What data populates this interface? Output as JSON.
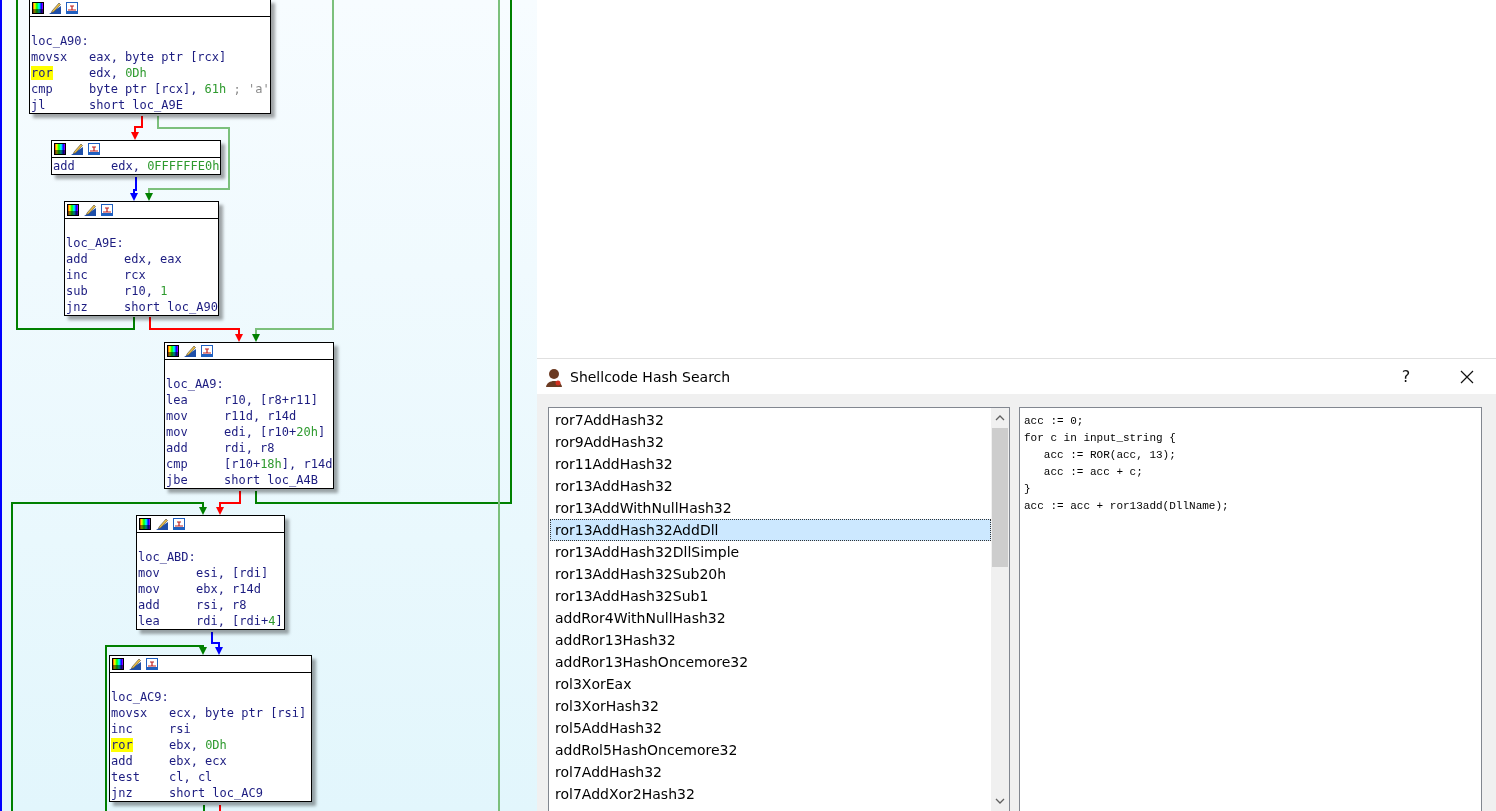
{
  "graph": {
    "nodes": [
      {
        "label": "loc_A90:",
        "lines": [
          {
            "mnemonic": "movsx",
            "highlighted": false,
            "operands": [
              {
                "kind": "text",
                "text": "eax, byte ptr [rcx]"
              }
            ]
          },
          {
            "mnemonic": "ror",
            "highlighted": true,
            "operands": [
              {
                "kind": "text",
                "text": "edx, "
              },
              {
                "kind": "number",
                "text": "0Dh"
              }
            ]
          },
          {
            "mnemonic": "cmp",
            "highlighted": false,
            "operands": [
              {
                "kind": "text",
                "text": "byte ptr [rcx], "
              },
              {
                "kind": "number",
                "text": "61h"
              },
              {
                "kind": "comment",
                "text": " ; 'a'"
              }
            ]
          },
          {
            "mnemonic": "jl",
            "highlighted": false,
            "operands": [
              {
                "kind": "text",
                "text": "short loc_A9E"
              }
            ]
          }
        ]
      },
      {
        "lines": [
          {
            "mnemonic": "add",
            "highlighted": false,
            "operands": [
              {
                "kind": "text",
                "text": "edx, "
              },
              {
                "kind": "number",
                "text": "0FFFFFFE0h"
              }
            ]
          }
        ]
      },
      {
        "label": "loc_A9E:",
        "lines": [
          {
            "mnemonic": "add",
            "highlighted": false,
            "operands": [
              {
                "kind": "text",
                "text": "edx, eax"
              }
            ]
          },
          {
            "mnemonic": "inc",
            "highlighted": false,
            "operands": [
              {
                "kind": "text",
                "text": "rcx"
              }
            ]
          },
          {
            "mnemonic": "sub",
            "highlighted": false,
            "operands": [
              {
                "kind": "text",
                "text": "r10, "
              },
              {
                "kind": "number",
                "text": "1"
              }
            ]
          },
          {
            "mnemonic": "jnz",
            "highlighted": false,
            "operands": [
              {
                "kind": "text",
                "text": "short loc_A90"
              }
            ]
          }
        ]
      },
      {
        "label": "loc_AA9:",
        "lines": [
          {
            "mnemonic": "lea",
            "highlighted": false,
            "operands": [
              {
                "kind": "text",
                "text": "r10, [r8+r11]"
              }
            ]
          },
          {
            "mnemonic": "mov",
            "highlighted": false,
            "operands": [
              {
                "kind": "text",
                "text": "r11d, r14d"
              }
            ]
          },
          {
            "mnemonic": "mov",
            "highlighted": false,
            "operands": [
              {
                "kind": "text",
                "text": "edi, [r10+"
              },
              {
                "kind": "number",
                "text": "20h"
              },
              {
                "kind": "text",
                "text": "]"
              }
            ]
          },
          {
            "mnemonic": "add",
            "highlighted": false,
            "operands": [
              {
                "kind": "text",
                "text": "rdi, r8"
              }
            ]
          },
          {
            "mnemonic": "cmp",
            "highlighted": false,
            "operands": [
              {
                "kind": "text",
                "text": "[r10+"
              },
              {
                "kind": "number",
                "text": "18h"
              },
              {
                "kind": "text",
                "text": "], r14d"
              }
            ]
          },
          {
            "mnemonic": "jbe",
            "highlighted": false,
            "operands": [
              {
                "kind": "text",
                "text": "short loc_A4B"
              }
            ]
          }
        ]
      },
      {
        "label": "loc_ABD:",
        "lines": [
          {
            "mnemonic": "mov",
            "highlighted": false,
            "operands": [
              {
                "kind": "text",
                "text": "esi, [rdi]"
              }
            ]
          },
          {
            "mnemonic": "mov",
            "highlighted": false,
            "operands": [
              {
                "kind": "text",
                "text": "ebx, r14d"
              }
            ]
          },
          {
            "mnemonic": "add",
            "highlighted": false,
            "operands": [
              {
                "kind": "text",
                "text": "rsi, r8"
              }
            ]
          },
          {
            "mnemonic": "lea",
            "highlighted": false,
            "operands": [
              {
                "kind": "text",
                "text": "rdi, [rdi+"
              },
              {
                "kind": "number",
                "text": "4"
              },
              {
                "kind": "text",
                "text": "]"
              }
            ]
          }
        ]
      },
      {
        "label": "loc_AC9:",
        "lines": [
          {
            "mnemonic": "movsx",
            "highlighted": false,
            "operands": [
              {
                "kind": "text",
                "text": "ecx, byte ptr [rsi]"
              }
            ]
          },
          {
            "mnemonic": "inc",
            "highlighted": false,
            "operands": [
              {
                "kind": "text",
                "text": "rsi"
              }
            ]
          },
          {
            "mnemonic": "ror",
            "highlighted": true,
            "operands": [
              {
                "kind": "text",
                "text": "ebx, "
              },
              {
                "kind": "number",
                "text": "0Dh"
              }
            ]
          },
          {
            "mnemonic": "add",
            "highlighted": false,
            "operands": [
              {
                "kind": "text",
                "text": "ebx, ecx"
              }
            ]
          },
          {
            "mnemonic": "test",
            "highlighted": false,
            "operands": [
              {
                "kind": "text",
                "text": "cl, cl"
              }
            ]
          },
          {
            "mnemonic": "jnz",
            "highlighted": false,
            "operands": [
              {
                "kind": "text",
                "text": "short loc_AC9"
              }
            ]
          }
        ]
      }
    ]
  },
  "dialog": {
    "title": "Shellcode Hash Search",
    "help": "?",
    "list": {
      "items": [
        {
          "label": "ror7AddHash32",
          "selected": false
        },
        {
          "label": "ror9AddHash32",
          "selected": false
        },
        {
          "label": "ror11AddHash32",
          "selected": false
        },
        {
          "label": "ror13AddHash32",
          "selected": false
        },
        {
          "label": "ror13AddWithNullHash32",
          "selected": false
        },
        {
          "label": "ror13AddHash32AddDll",
          "selected": true
        },
        {
          "label": "ror13AddHash32DllSimple",
          "selected": false
        },
        {
          "label": "ror13AddHash32Sub20h",
          "selected": false
        },
        {
          "label": "ror13AddHash32Sub1",
          "selected": false
        },
        {
          "label": "addRor4WithNullHash32",
          "selected": false
        },
        {
          "label": "addRor13Hash32",
          "selected": false
        },
        {
          "label": "addRor13HashOncemore32",
          "selected": false
        },
        {
          "label": "rol3XorEax",
          "selected": false
        },
        {
          "label": "rol3XorHash32",
          "selected": false
        },
        {
          "label": "rol5AddHash32",
          "selected": false
        },
        {
          "label": "addRol5HashOncemore32",
          "selected": false
        },
        {
          "label": "rol7AddHash32",
          "selected": false
        },
        {
          "label": "rol7AddXor2Hash32",
          "selected": false
        }
      ]
    },
    "description": {
      "lines": [
        "acc := 0;",
        "for c in input_string {",
        "   acc := ROR(acc, 13);",
        "   acc := acc + c;",
        "}",
        "acc := acc + ror13add(DllName);"
      ]
    }
  }
}
